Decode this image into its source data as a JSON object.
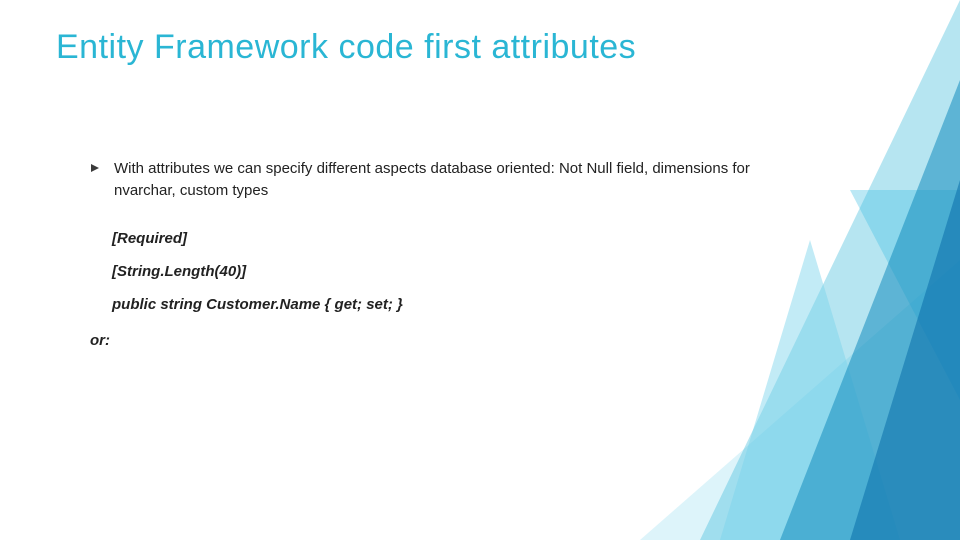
{
  "title": "Entity Framework code first attributes",
  "bullet": {
    "text": "With attributes we can specify different aspects database oriented: Not Null field, dimensions for nvarchar, custom types"
  },
  "code": {
    "line1": "[Required]",
    "line2": "[String.Length(40)]",
    "line3": "public string Customer.Name { get; set; }"
  },
  "or_label": "or:"
}
